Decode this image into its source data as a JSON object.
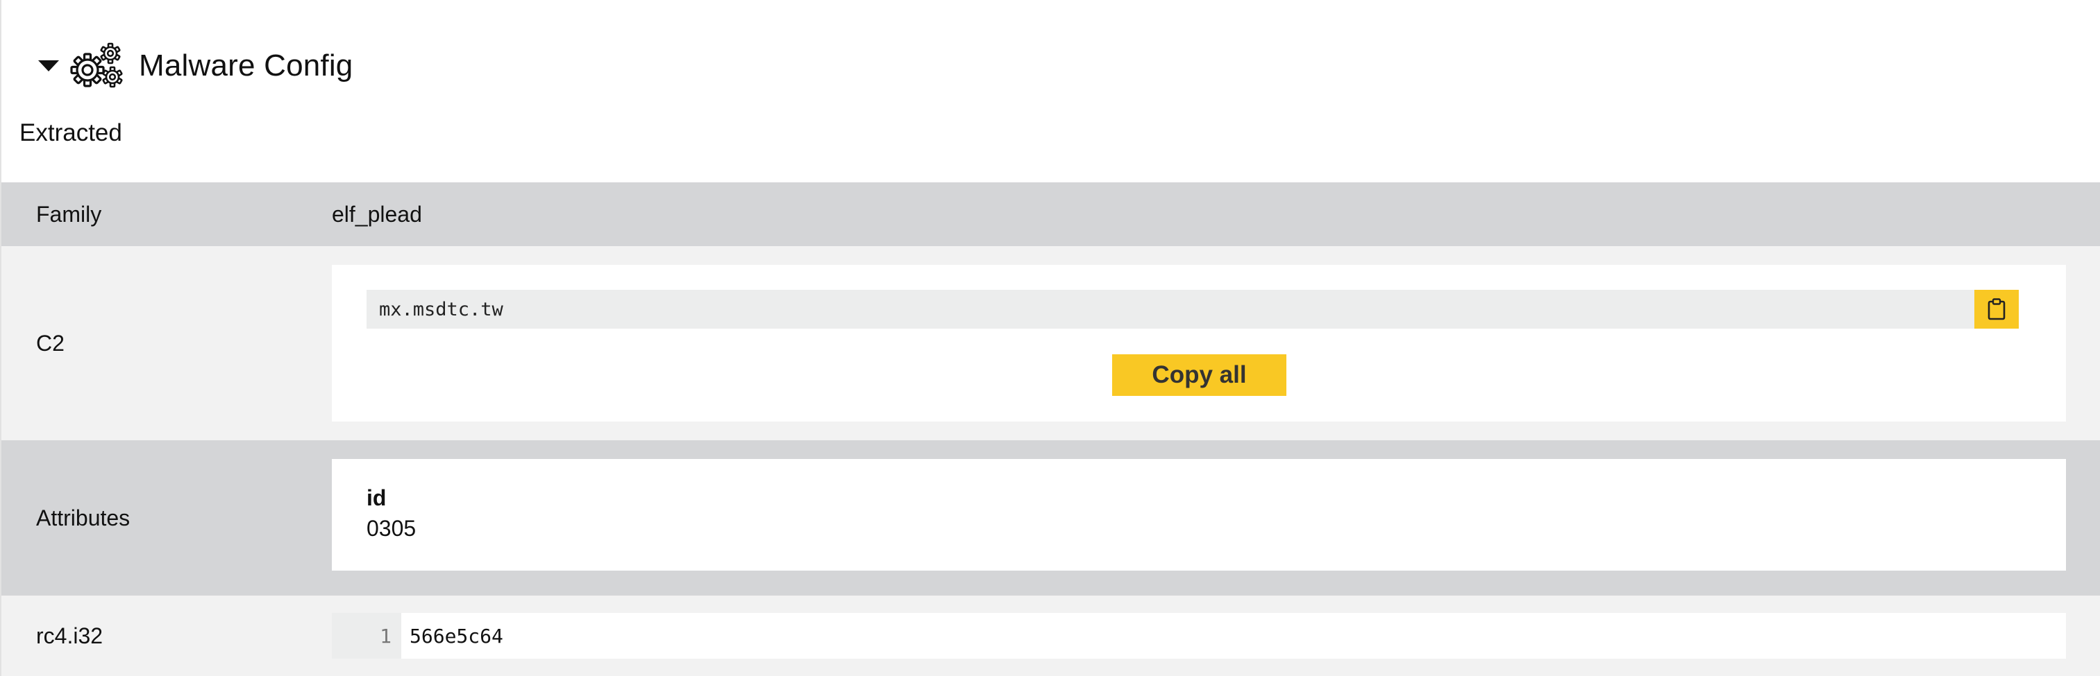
{
  "section": {
    "title": "Malware Config",
    "subtitle": "Extracted",
    "icons": {
      "toggle": "caret-down-icon",
      "section": "gears-icon",
      "copy": "clipboard-icon"
    }
  },
  "rows": {
    "family": {
      "label": "Family",
      "value": "elf_plead"
    },
    "c2": {
      "label": "C2",
      "entries": [
        "mx.msdtc.tw"
      ],
      "copy_all_label": "Copy all"
    },
    "attributes": {
      "label": "Attributes",
      "key": "id",
      "value": "0305"
    },
    "rc4": {
      "label": "rc4.i32",
      "line_number": "1",
      "value": "566e5c64"
    }
  },
  "colors": {
    "accent": "#f9c824",
    "row_dark": "#d4d5d7",
    "row_light": "#f2f2f2",
    "field_bg": "#eceded"
  }
}
